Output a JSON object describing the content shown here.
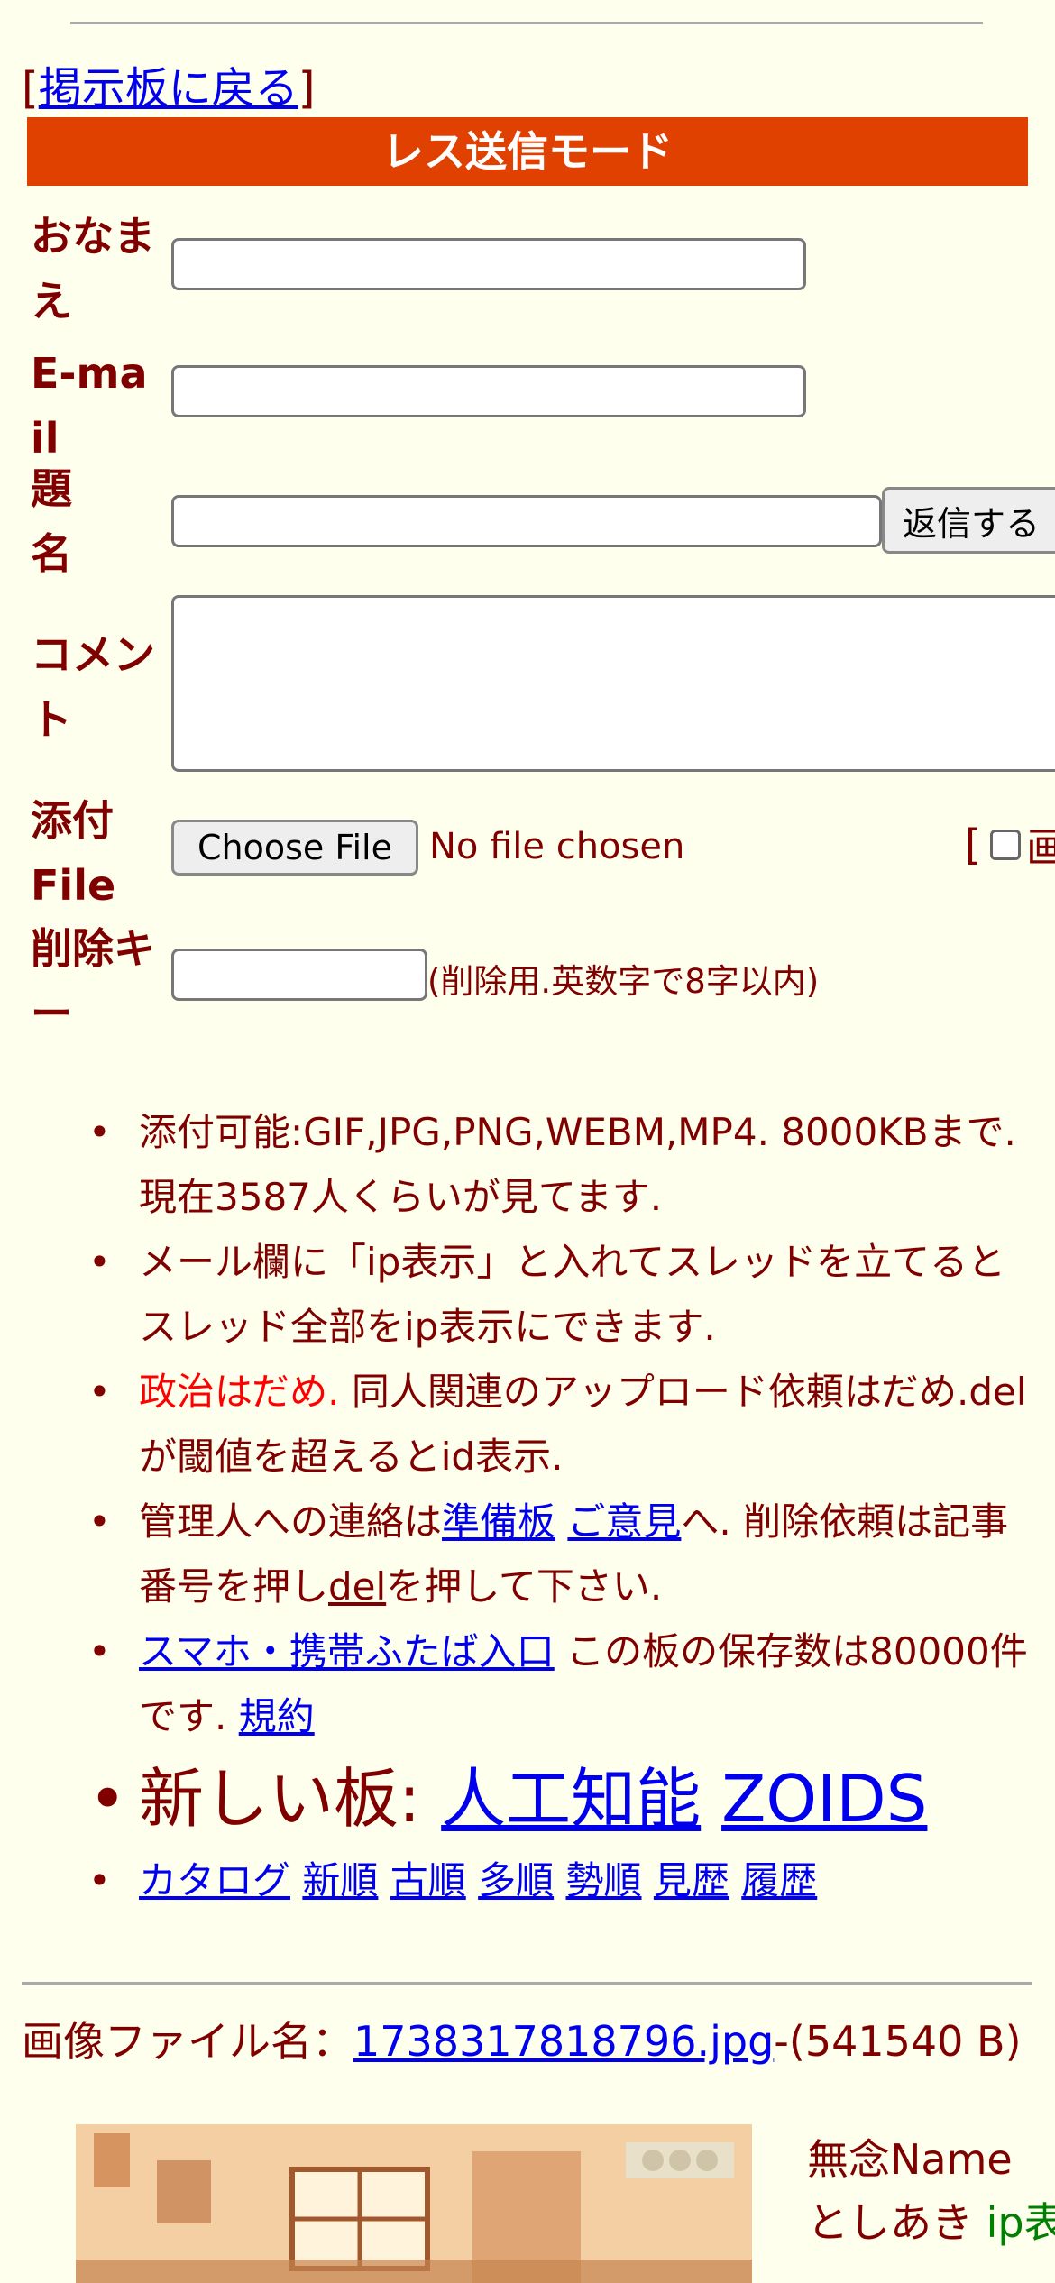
{
  "nav": {
    "back_link": "掲示板に戻る",
    "bracket_open": "[",
    "bracket_close": "]"
  },
  "form": {
    "mode_title": "レス送信モード",
    "name_label": "おなまえ",
    "email_label": "E-mail",
    "subject_label": "題名",
    "submit_label": "返信する",
    "comment_label": "コメント",
    "attach_label": "添付File",
    "choose_file_label": "Choose File",
    "no_file_text": "No file chosen",
    "image_opt_bracket": "[",
    "image_opt_label": "画",
    "delkey_label": "削除キー",
    "delkey_hint": "(削除用.英数字で8字以内)"
  },
  "notes": {
    "n1": "添付可能:GIF,JPG,PNG,WEBM,MP4. 8000KBまで. 現在3587人くらいが見てます.",
    "n2": "メール欄に「ip表示」と入れてスレッドを立てるとスレッド全部をip表示にできます.",
    "n3_red": "政治はだめ.",
    "n3_rest": " 同人関連のアップロード依頼はだめ.delが閾値を超えるとid表示.",
    "n4_pre": "管理人への連絡は",
    "n4_link1": "準備板",
    "n4_link2": "ご意見",
    "n4_mid": "へ. 削除依頼は記事番号を押し",
    "n4_del": "del",
    "n4_post": "を押して下さい.",
    "n5_link": "スマホ・携帯ふたば入口",
    "n5_mid": " この板の保存数は80000件です. ",
    "n5_rules": "規約",
    "n6_label": "新しい板: ",
    "n6_link1": "人工知能",
    "n6_link2": "ZOIDS",
    "sort": [
      "カタログ",
      "新順",
      "古順",
      "多順",
      "勢順",
      "見歴",
      "履歴"
    ]
  },
  "post": {
    "file_label": "画像ファイル名：",
    "file_name": "1738317818796.jpg",
    "file_size": "-(541540 B)",
    "name": "無念Name",
    "poster": "としあき",
    "ip_text": "ip表示"
  },
  "colors": {
    "accent": "#e04000",
    "text": "#800000",
    "link": "#0000ee",
    "background": "#ffffee",
    "warning": "#ff0000",
    "ip": "#008000"
  }
}
